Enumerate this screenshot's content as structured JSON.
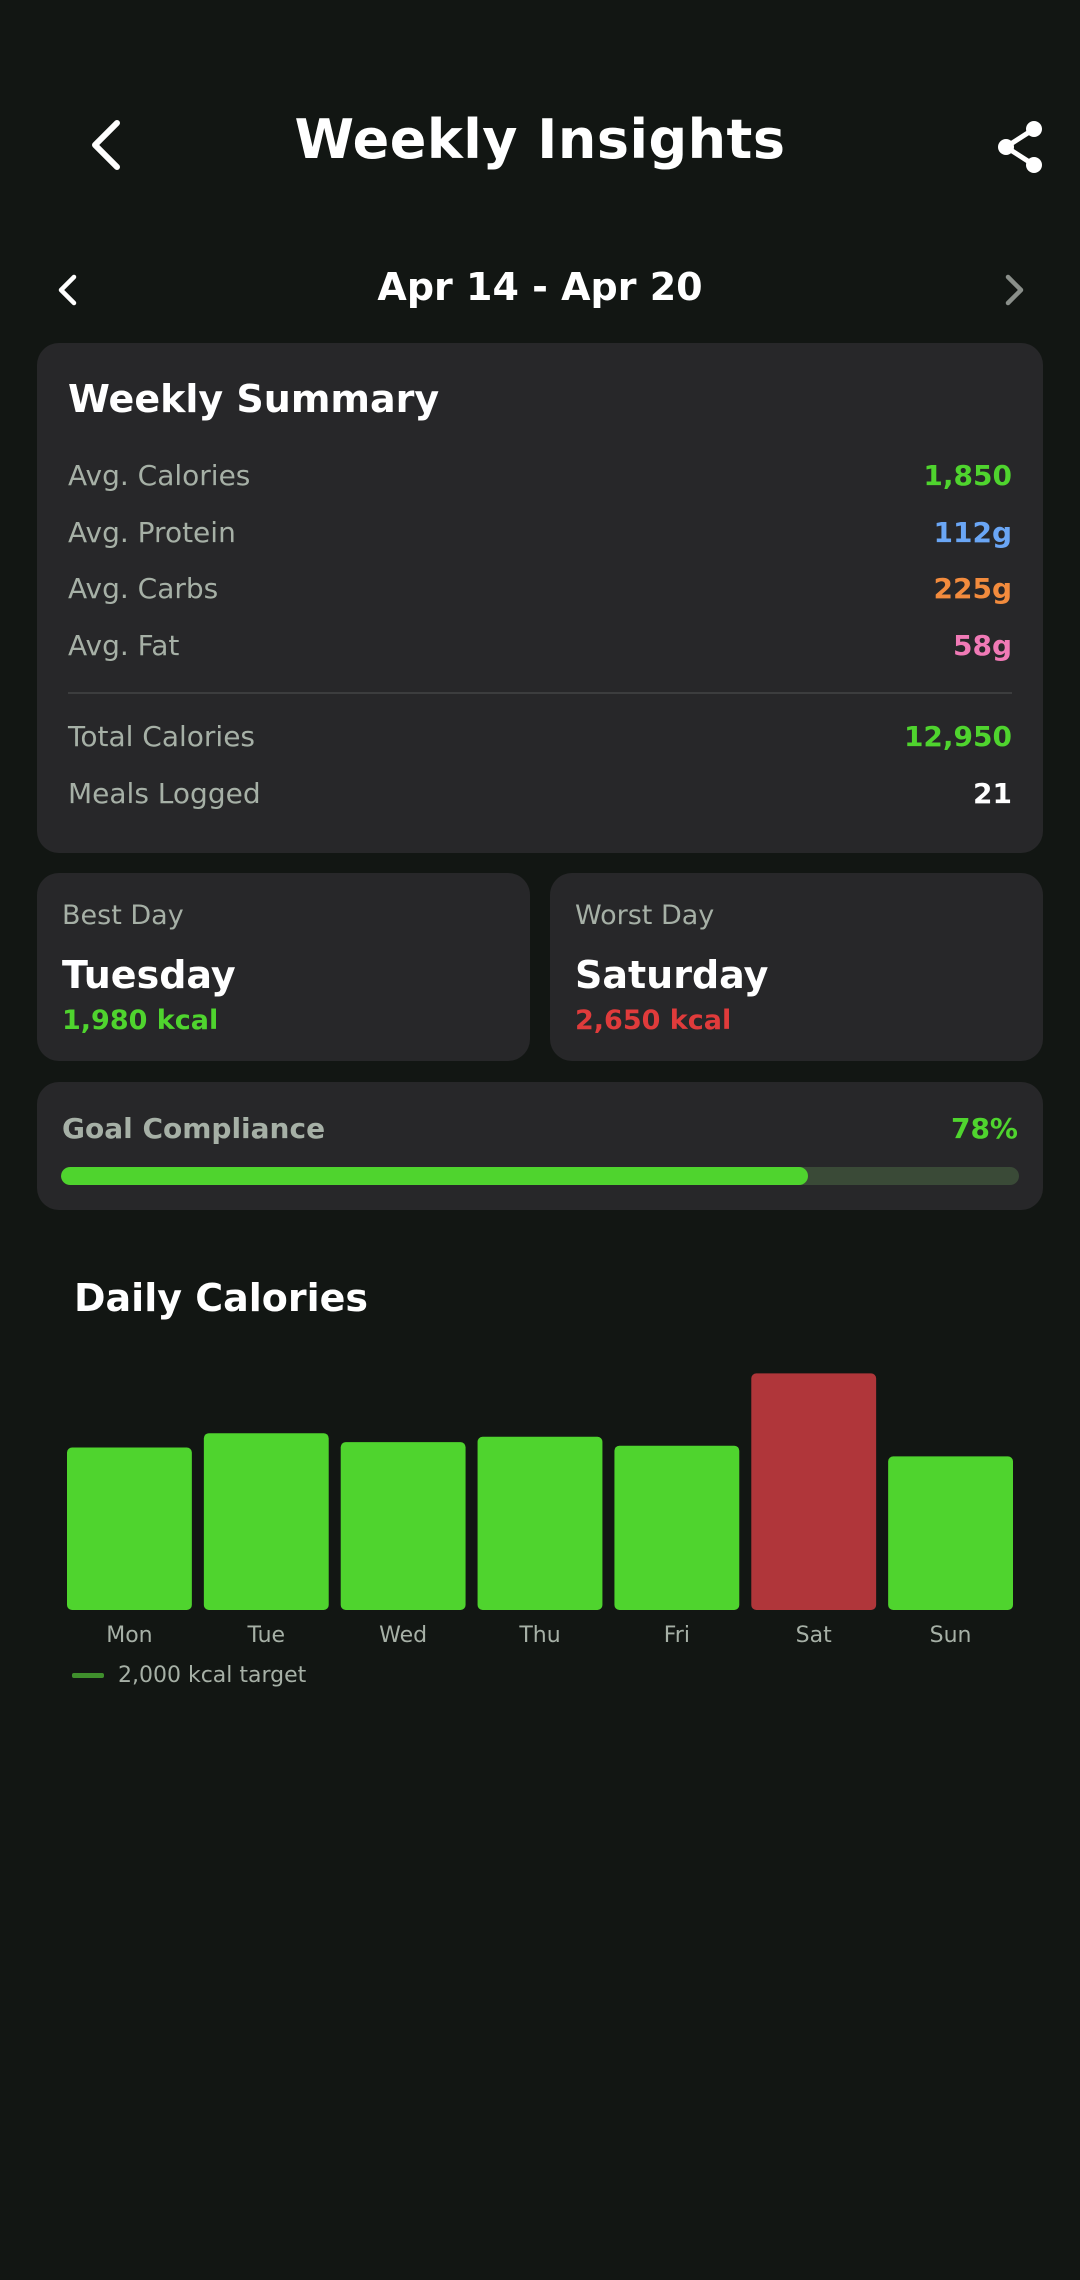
{
  "header": {
    "title": "Weekly Insights",
    "back_icon": "chevron-left-icon",
    "share_icon": "share-icon"
  },
  "week_nav": {
    "label": "Apr 14 - Apr 20",
    "prev_icon": "chevron-left-icon",
    "next_icon": "chevron-right-icon"
  },
  "summary": {
    "title": "Weekly Summary",
    "stats": [
      {
        "label": "Avg. Calories",
        "value": "1,850",
        "color": "#4fd42e"
      },
      {
        "label": "Avg. Protein",
        "value": "112g",
        "color": "#6aa6f5"
      },
      {
        "label": "Avg. Carbs",
        "value": "225g",
        "color": "#f28b3d"
      },
      {
        "label": "Avg. Fat",
        "value": "58g",
        "color": "#f07ab6"
      }
    ],
    "totals": [
      {
        "label": "Total Calories",
        "value": "12,950",
        "color": "#4fd42e"
      },
      {
        "label": "Meals Logged",
        "value": "21",
        "color": "#ffffff"
      }
    ]
  },
  "best_day": {
    "caption": "Best Day",
    "day": "Tuesday",
    "kcal": "1,980 kcal",
    "color": "#4fd42e"
  },
  "worst_day": {
    "caption": "Worst Day",
    "day": "Saturday",
    "kcal": "2,650 kcal",
    "color": "#e03b3b"
  },
  "goal": {
    "label": "Goal Compliance",
    "percent_label": "78%",
    "percent": 78
  },
  "chart_title": "Daily Calories",
  "chart_data": {
    "type": "bar",
    "categories": [
      "Mon",
      "Tue",
      "Wed",
      "Thu",
      "Fri",
      "Sat",
      "Sun"
    ],
    "values": [
      1820,
      1980,
      1880,
      1940,
      1840,
      2650,
      1720
    ],
    "ylim": [
      0,
      2800
    ],
    "bar_color": "#4fd42e",
    "highlight_color": "#b0363a",
    "highlight_index": 5,
    "target_value": 2000,
    "legend": "2,000 kcal target"
  }
}
